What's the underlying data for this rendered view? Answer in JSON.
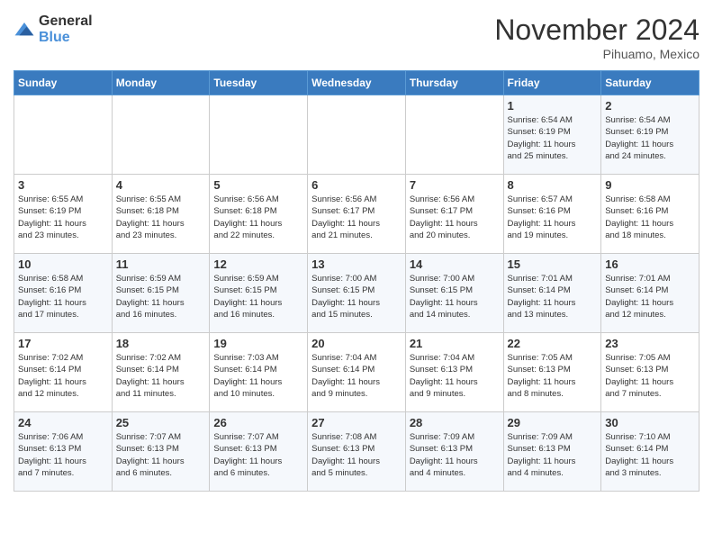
{
  "logo": {
    "general": "General",
    "blue": "Blue"
  },
  "title": "November 2024",
  "location": "Pihuamo, Mexico",
  "days_of_week": [
    "Sunday",
    "Monday",
    "Tuesday",
    "Wednesday",
    "Thursday",
    "Friday",
    "Saturday"
  ],
  "weeks": [
    [
      {
        "day": "",
        "info": ""
      },
      {
        "day": "",
        "info": ""
      },
      {
        "day": "",
        "info": ""
      },
      {
        "day": "",
        "info": ""
      },
      {
        "day": "",
        "info": ""
      },
      {
        "day": "1",
        "info": "Sunrise: 6:54 AM\nSunset: 6:19 PM\nDaylight: 11 hours\nand 25 minutes."
      },
      {
        "day": "2",
        "info": "Sunrise: 6:54 AM\nSunset: 6:19 PM\nDaylight: 11 hours\nand 24 minutes."
      }
    ],
    [
      {
        "day": "3",
        "info": "Sunrise: 6:55 AM\nSunset: 6:19 PM\nDaylight: 11 hours\nand 23 minutes."
      },
      {
        "day": "4",
        "info": "Sunrise: 6:55 AM\nSunset: 6:18 PM\nDaylight: 11 hours\nand 23 minutes."
      },
      {
        "day": "5",
        "info": "Sunrise: 6:56 AM\nSunset: 6:18 PM\nDaylight: 11 hours\nand 22 minutes."
      },
      {
        "day": "6",
        "info": "Sunrise: 6:56 AM\nSunset: 6:17 PM\nDaylight: 11 hours\nand 21 minutes."
      },
      {
        "day": "7",
        "info": "Sunrise: 6:56 AM\nSunset: 6:17 PM\nDaylight: 11 hours\nand 20 minutes."
      },
      {
        "day": "8",
        "info": "Sunrise: 6:57 AM\nSunset: 6:16 PM\nDaylight: 11 hours\nand 19 minutes."
      },
      {
        "day": "9",
        "info": "Sunrise: 6:58 AM\nSunset: 6:16 PM\nDaylight: 11 hours\nand 18 minutes."
      }
    ],
    [
      {
        "day": "10",
        "info": "Sunrise: 6:58 AM\nSunset: 6:16 PM\nDaylight: 11 hours\nand 17 minutes."
      },
      {
        "day": "11",
        "info": "Sunrise: 6:59 AM\nSunset: 6:15 PM\nDaylight: 11 hours\nand 16 minutes."
      },
      {
        "day": "12",
        "info": "Sunrise: 6:59 AM\nSunset: 6:15 PM\nDaylight: 11 hours\nand 16 minutes."
      },
      {
        "day": "13",
        "info": "Sunrise: 7:00 AM\nSunset: 6:15 PM\nDaylight: 11 hours\nand 15 minutes."
      },
      {
        "day": "14",
        "info": "Sunrise: 7:00 AM\nSunset: 6:15 PM\nDaylight: 11 hours\nand 14 minutes."
      },
      {
        "day": "15",
        "info": "Sunrise: 7:01 AM\nSunset: 6:14 PM\nDaylight: 11 hours\nand 13 minutes."
      },
      {
        "day": "16",
        "info": "Sunrise: 7:01 AM\nSunset: 6:14 PM\nDaylight: 11 hours\nand 12 minutes."
      }
    ],
    [
      {
        "day": "17",
        "info": "Sunrise: 7:02 AM\nSunset: 6:14 PM\nDaylight: 11 hours\nand 12 minutes."
      },
      {
        "day": "18",
        "info": "Sunrise: 7:02 AM\nSunset: 6:14 PM\nDaylight: 11 hours\nand 11 minutes."
      },
      {
        "day": "19",
        "info": "Sunrise: 7:03 AM\nSunset: 6:14 PM\nDaylight: 11 hours\nand 10 minutes."
      },
      {
        "day": "20",
        "info": "Sunrise: 7:04 AM\nSunset: 6:14 PM\nDaylight: 11 hours\nand 9 minutes."
      },
      {
        "day": "21",
        "info": "Sunrise: 7:04 AM\nSunset: 6:13 PM\nDaylight: 11 hours\nand 9 minutes."
      },
      {
        "day": "22",
        "info": "Sunrise: 7:05 AM\nSunset: 6:13 PM\nDaylight: 11 hours\nand 8 minutes."
      },
      {
        "day": "23",
        "info": "Sunrise: 7:05 AM\nSunset: 6:13 PM\nDaylight: 11 hours\nand 7 minutes."
      }
    ],
    [
      {
        "day": "24",
        "info": "Sunrise: 7:06 AM\nSunset: 6:13 PM\nDaylight: 11 hours\nand 7 minutes."
      },
      {
        "day": "25",
        "info": "Sunrise: 7:07 AM\nSunset: 6:13 PM\nDaylight: 11 hours\nand 6 minutes."
      },
      {
        "day": "26",
        "info": "Sunrise: 7:07 AM\nSunset: 6:13 PM\nDaylight: 11 hours\nand 6 minutes."
      },
      {
        "day": "27",
        "info": "Sunrise: 7:08 AM\nSunset: 6:13 PM\nDaylight: 11 hours\nand 5 minutes."
      },
      {
        "day": "28",
        "info": "Sunrise: 7:09 AM\nSunset: 6:13 PM\nDaylight: 11 hours\nand 4 minutes."
      },
      {
        "day": "29",
        "info": "Sunrise: 7:09 AM\nSunset: 6:13 PM\nDaylight: 11 hours\nand 4 minutes."
      },
      {
        "day": "30",
        "info": "Sunrise: 7:10 AM\nSunset: 6:14 PM\nDaylight: 11 hours\nand 3 minutes."
      }
    ]
  ]
}
